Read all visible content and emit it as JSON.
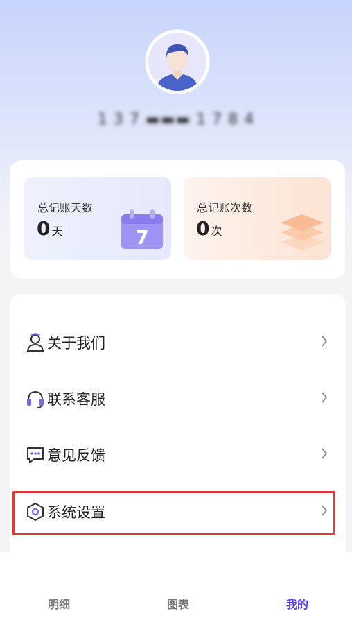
{
  "profile": {
    "username": "1 3 7 ▬▬▬ 1 7 8 4"
  },
  "stats": {
    "days": {
      "label": "总记账天数",
      "value": "0",
      "unit": "天",
      "icon_day": "7"
    },
    "count": {
      "label": "总记账次数",
      "value": "0",
      "unit": "次"
    }
  },
  "menu": {
    "items": [
      {
        "label": "关于我们",
        "icon": "person-icon"
      },
      {
        "label": "联系客服",
        "icon": "headset-icon"
      },
      {
        "label": "意见反馈",
        "icon": "chat-bubble-icon"
      },
      {
        "label": "系统设置",
        "icon": "settings-hex-icon"
      }
    ]
  },
  "tabbar": {
    "tabs": [
      {
        "label": "明细",
        "active": false
      },
      {
        "label": "图表",
        "active": false
      },
      {
        "label": "我的",
        "active": true
      }
    ]
  },
  "colors": {
    "accent": "#5b3df5",
    "icon_purple": "#7b68ee",
    "highlight_red": "#e53935"
  }
}
